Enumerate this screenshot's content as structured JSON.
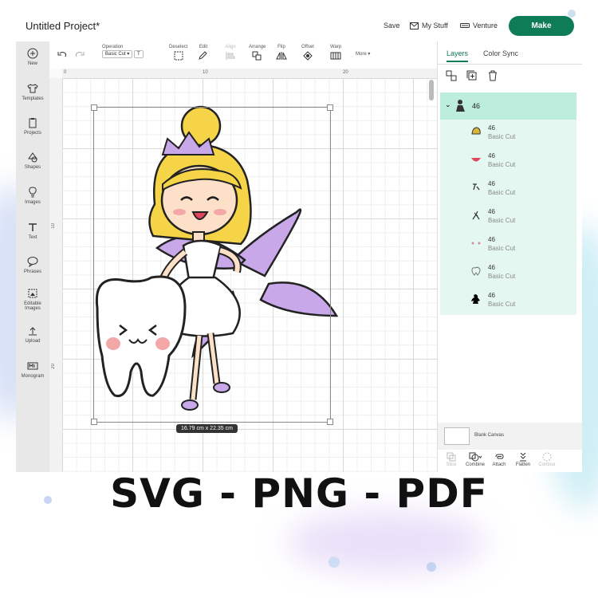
{
  "header": {
    "project_title": "Untitled Project*",
    "save_label": "Save",
    "mystuff_label": "My Stuff",
    "venture_label": "Venture",
    "make_label": "Make"
  },
  "sidebar": {
    "items": [
      {
        "label": "New"
      },
      {
        "label": "Templates"
      },
      {
        "label": "Projects"
      },
      {
        "label": "Shapes"
      },
      {
        "label": "Images"
      },
      {
        "label": "Text"
      },
      {
        "label": "Phrases"
      },
      {
        "label": "Editable",
        "label2": "Images"
      },
      {
        "label": "Upload"
      },
      {
        "label": "Monogram"
      }
    ]
  },
  "toolbar": {
    "operation_label": "Operation",
    "operation_value": "Basic Cut",
    "deselect_label": "Deselect",
    "edit_label": "Edit",
    "align_label": "Align",
    "arrange_label": "Arrange",
    "flip_label": "Flip",
    "offset_label": "Offset",
    "warp_label": "Warp",
    "more_label": "More ▾"
  },
  "canvas": {
    "ruler_top": [
      "0",
      "10",
      "20"
    ],
    "ruler_left": [
      "10",
      "20"
    ],
    "size_tag": "16.79  cm x 22.35  cm"
  },
  "panel": {
    "tab_layers": "Layers",
    "tab_colorsync": "Color Sync",
    "group_name": "46",
    "layers": [
      {
        "name": "46",
        "op": "Basic Cut",
        "color": "#d9b73a"
      },
      {
        "name": "46",
        "op": "Basic Cut",
        "color": "#e0475d"
      },
      {
        "name": "46",
        "op": "Basic Cut",
        "color": "#333333"
      },
      {
        "name": "46",
        "op": "Basic Cut",
        "color": "#333333"
      },
      {
        "name": "46",
        "op": "Basic Cut",
        "color": "#d98a9a"
      },
      {
        "name": "46",
        "op": "Basic Cut",
        "color": "#777777"
      },
      {
        "name": "46",
        "op": "Basic Cut",
        "color": "#000000"
      }
    ],
    "blank_canvas_label": "Blank Canvas",
    "actions": {
      "slice": "Slice",
      "combine": "Combine",
      "attach": "Attach",
      "flatten": "Flatten",
      "contour": "Contour"
    }
  },
  "footer": {
    "formats": "SVG - PNG - PDF"
  },
  "colors": {
    "accent": "#0e7c57",
    "layer_bg": "#e4f7f0",
    "layer_head": "#bdeedd",
    "wing": "#c8a8e8",
    "hair": "#f5d547"
  }
}
